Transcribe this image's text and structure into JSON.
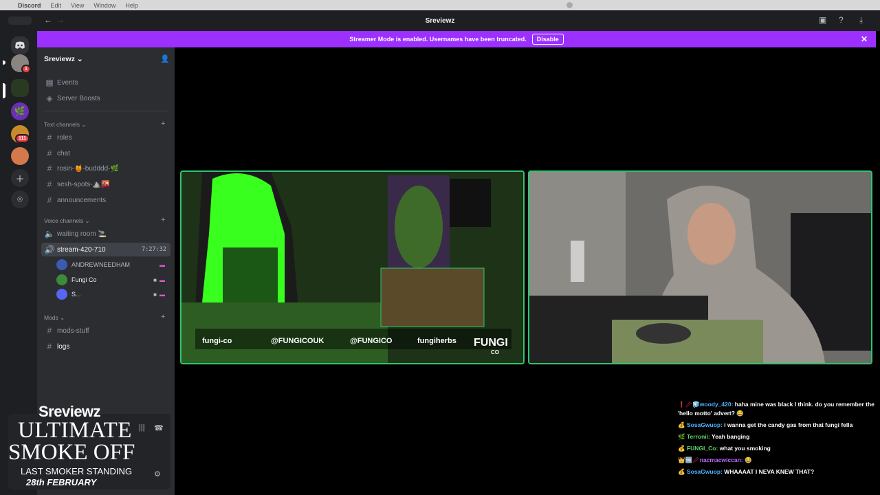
{
  "menubar": {
    "app": "Discord",
    "items": [
      "Edit",
      "View",
      "Window",
      "Help"
    ]
  },
  "window": {
    "title": "Sreviewz"
  },
  "banner": {
    "text": "Streamer Mode is enabled. Usernames have been truncated.",
    "button": "Disable"
  },
  "rail": {
    "badges": [
      "1",
      "111"
    ]
  },
  "sidebar": {
    "server_name": "Sreviewz",
    "top_items": [
      {
        "icon": "calendar-icon",
        "label": "Events"
      },
      {
        "icon": "boost-icon",
        "label": "Server Boosts"
      }
    ],
    "text_category": "Text channels",
    "text_channels": [
      "roles",
      "chat",
      "rosin-🍯-budddd-🌿",
      "sesh-spots-⛰️🌇",
      "announcements"
    ],
    "voice_category": "Voice channels",
    "voice_channels": [
      {
        "label": "waiting room 🚬"
      },
      {
        "label": "stream-420-710",
        "timer": "7:27:32"
      }
    ],
    "members": [
      "ANDREWNEEDHAM",
      "Fungi Co",
      "S..."
    ],
    "mods_category": "Mods",
    "mod_channels": [
      "mods-stuff",
      "logs"
    ]
  },
  "overlay": {
    "name": "Sreviewz",
    "title_line1": "ULTIMATE",
    "title_line2": "SMOKE OFF",
    "subtitle": "LAST SMOKER STANDING",
    "date": "28th FEBRUARY"
  },
  "stage": {
    "tile1_socials": [
      "fungi-co",
      "@FUNGICOUK",
      "@FUNGICO",
      "fungiherbs"
    ],
    "tile1_brand": "FUNGI",
    "tile1_brand_sub": "CO"
  },
  "chat": [
    {
      "badges": "❗🥢🧊",
      "user": "woody_420:",
      "text": "haha mine was black I think. do you remember the 'hello motto' advert? 😂",
      "color": "blue"
    },
    {
      "badges": "💰",
      "user": "SosaGwuop:",
      "text": "i wanna get the candy gas from that fungi fella",
      "color": "blue"
    },
    {
      "badges": "🌿",
      "user": "Terronii:",
      "text": "Yeah banging",
      "color": "green"
    },
    {
      "badges": "💰",
      "user": "FUNGI_Co:",
      "text": "what you smoking",
      "color": "green"
    },
    {
      "badges": "👑🆒🥢",
      "user": "nacmacwiccan:",
      "text": "😂",
      "color": "purple"
    },
    {
      "badges": "💰",
      "user": "SosaGwuop:",
      "text": "WHAAAAT I NEVA KNEW THAT?",
      "color": "blue"
    }
  ],
  "colors": {
    "accent": "#9b30ff",
    "speaking": "#2dc770",
    "sidebar": "#2b2d31",
    "rail": "#1e1f22"
  }
}
